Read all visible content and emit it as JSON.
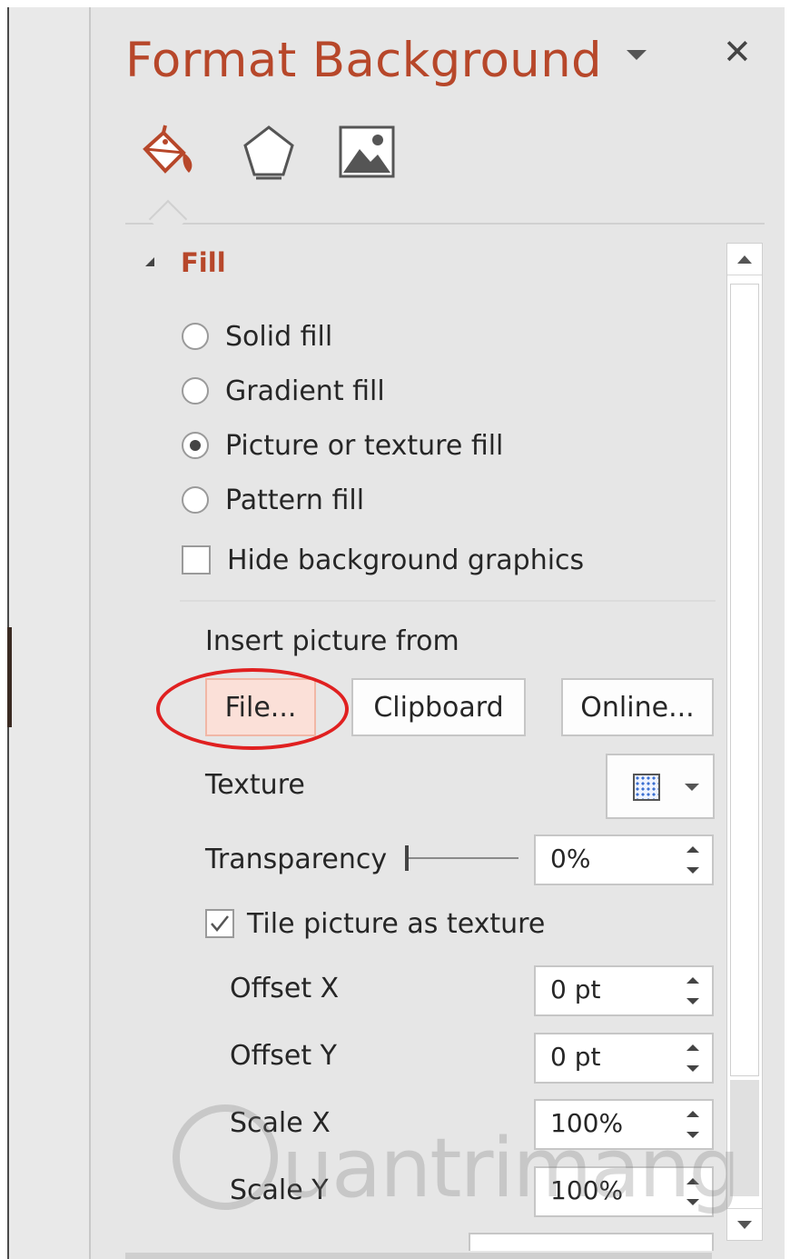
{
  "pane": {
    "title": "Format Background",
    "close_glyph": "✕"
  },
  "tabs": [
    {
      "name": "fill-line-tab",
      "icon": "paint-bucket-icon",
      "active": true
    },
    {
      "name": "effects-tab",
      "icon": "pentagon-icon",
      "active": false
    },
    {
      "name": "picture-tab",
      "icon": "picture-icon",
      "active": false
    }
  ],
  "fill": {
    "section_title": "Fill",
    "options": [
      {
        "label": "Solid fill",
        "selected": false
      },
      {
        "label": "Gradient fill",
        "selected": false
      },
      {
        "label": "Picture or texture fill",
        "selected": true
      },
      {
        "label": "Pattern fill",
        "selected": false
      }
    ],
    "hide_background_graphics": {
      "label": "Hide background graphics",
      "checked": false
    },
    "insert_picture_from": "Insert picture from",
    "buttons": {
      "file": "File...",
      "clipboard": "Clipboard",
      "online": "Online..."
    },
    "texture_label": "Texture",
    "transparency": {
      "label": "Transparency",
      "value": "0%",
      "level": 0
    },
    "tile": {
      "label": "Tile picture as texture",
      "checked": true
    },
    "offset_x": {
      "label": "Offset X",
      "value": "0 pt"
    },
    "offset_y": {
      "label": "Offset Y",
      "value": "0 pt"
    },
    "scale_x": {
      "label": "Scale X",
      "value": "100%"
    },
    "scale_y": {
      "label": "Scale Y",
      "value": "100%"
    }
  },
  "colors": {
    "accent": "#b7472a",
    "highlight_circle": "#e02020",
    "file_button_bg": "#fbe0d8"
  },
  "watermark": {
    "text": "uantrimang"
  }
}
